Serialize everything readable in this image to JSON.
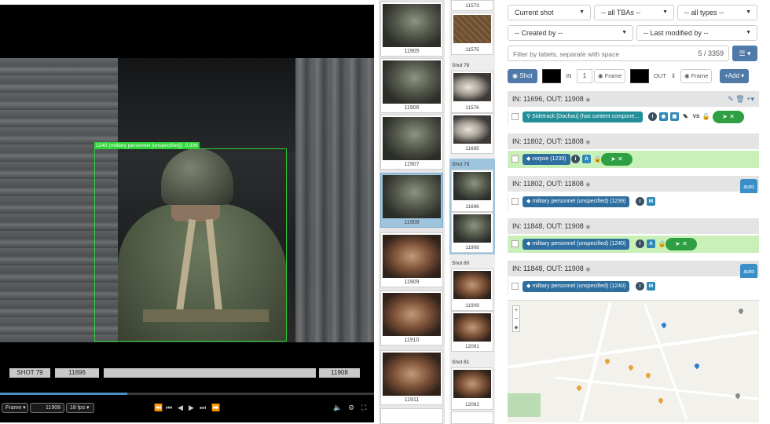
{
  "player": {
    "bbox_label": "1240 (military personnel [unspecified]): 0.306",
    "shot_label": "SHOT 79",
    "in_frame": "11696",
    "out_frame": "11908",
    "progress_fraction": 0.34,
    "mode_select": "Frame",
    "frame_value": "11908",
    "fps_select": "18 fps"
  },
  "thumbnails": [
    {
      "num": "11905",
      "style": "soldier",
      "active": false
    },
    {
      "num": "11906",
      "style": "soldier",
      "active": false
    },
    {
      "num": "11907",
      "style": "soldier",
      "active": false
    },
    {
      "num": "11908",
      "style": "soldier",
      "active": true
    },
    {
      "num": "11909",
      "style": "fire",
      "active": false
    },
    {
      "num": "11910",
      "style": "fire",
      "active": false
    },
    {
      "num": "11911",
      "style": "fire",
      "active": false
    }
  ],
  "shots": {
    "top_num": "11573",
    "gold_num": "11575",
    "groups": [
      {
        "label": "Shot 78",
        "frames": [
          "11576",
          "11695"
        ]
      },
      {
        "label": "Shot 79",
        "frames": [
          "11696",
          "11908"
        ]
      },
      {
        "label": "Shot 80",
        "frames": [
          "11909",
          "12091"
        ]
      },
      {
        "label": "Shot 81",
        "frames": [
          "12092"
        ]
      }
    ]
  },
  "filters": {
    "shot_select": "Current shot",
    "tba_select": "-- all TBAs --",
    "type_select": "-- all types --",
    "created_select": "-- Created by --",
    "modified_select": "-- Last modified by --",
    "label_placeholder": "Filter by labels, separate with space",
    "count": "5 / 3359"
  },
  "toolbar": {
    "shot_btn": "Shot",
    "in_label": "IN",
    "in_value": "1",
    "frame_btn_1": "Frame",
    "out_label": "OUT",
    "frame_btn_2": "Frame",
    "add_btn": "+Add"
  },
  "annotations": [
    {
      "header": "IN: 11696, OUT: 11908",
      "tag": "Sidetrack [Dachau] (has content compone...",
      "tag_style": "teal",
      "green": false,
      "auto": false
    },
    {
      "header": "IN: 11802, OUT: 11808",
      "tag": "corpse (1239)",
      "tag_style": "blue",
      "green": true,
      "auto": false
    },
    {
      "header": "IN: 11802, OUT: 11808",
      "tag": "military personnel (unspecified) (1239)",
      "tag_style": "blue",
      "green": false,
      "auto": true
    },
    {
      "header": "IN: 11848, OUT: 11908",
      "tag": "military personnel (unspecified) (1240)",
      "tag_style": "blue",
      "green": true,
      "auto": false
    },
    {
      "header": "IN: 11848, OUT: 11908",
      "tag": "military personnel (unspecified) (1240)",
      "tag_style": "blue",
      "green": false,
      "auto": true
    }
  ],
  "auto_label": "auto",
  "vs_label": "VS",
  "colors": {
    "accent": "#4f79a8",
    "green": "#2ea043",
    "bbox": "#2fd33a"
  }
}
